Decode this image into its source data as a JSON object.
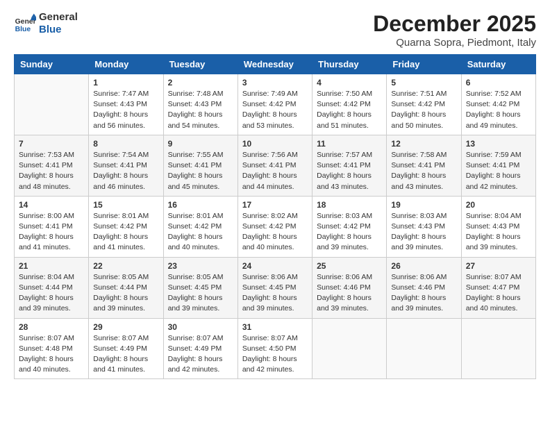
{
  "logo": {
    "general": "General",
    "blue": "Blue"
  },
  "title": {
    "month_year": "December 2025",
    "location": "Quarna Sopra, Piedmont, Italy"
  },
  "days_of_week": [
    "Sunday",
    "Monday",
    "Tuesday",
    "Wednesday",
    "Thursday",
    "Friday",
    "Saturday"
  ],
  "weeks": [
    {
      "shaded": false,
      "days": [
        {
          "num": "",
          "empty": true,
          "sunrise": "",
          "sunset": "",
          "daylight": ""
        },
        {
          "num": "1",
          "empty": false,
          "sunrise": "Sunrise: 7:47 AM",
          "sunset": "Sunset: 4:43 PM",
          "daylight": "Daylight: 8 hours and 56 minutes."
        },
        {
          "num": "2",
          "empty": false,
          "sunrise": "Sunrise: 7:48 AM",
          "sunset": "Sunset: 4:43 PM",
          "daylight": "Daylight: 8 hours and 54 minutes."
        },
        {
          "num": "3",
          "empty": false,
          "sunrise": "Sunrise: 7:49 AM",
          "sunset": "Sunset: 4:42 PM",
          "daylight": "Daylight: 8 hours and 53 minutes."
        },
        {
          "num": "4",
          "empty": false,
          "sunrise": "Sunrise: 7:50 AM",
          "sunset": "Sunset: 4:42 PM",
          "daylight": "Daylight: 8 hours and 51 minutes."
        },
        {
          "num": "5",
          "empty": false,
          "sunrise": "Sunrise: 7:51 AM",
          "sunset": "Sunset: 4:42 PM",
          "daylight": "Daylight: 8 hours and 50 minutes."
        },
        {
          "num": "6",
          "empty": false,
          "sunrise": "Sunrise: 7:52 AM",
          "sunset": "Sunset: 4:42 PM",
          "daylight": "Daylight: 8 hours and 49 minutes."
        }
      ]
    },
    {
      "shaded": true,
      "days": [
        {
          "num": "7",
          "empty": false,
          "sunrise": "Sunrise: 7:53 AM",
          "sunset": "Sunset: 4:41 PM",
          "daylight": "Daylight: 8 hours and 48 minutes."
        },
        {
          "num": "8",
          "empty": false,
          "sunrise": "Sunrise: 7:54 AM",
          "sunset": "Sunset: 4:41 PM",
          "daylight": "Daylight: 8 hours and 46 minutes."
        },
        {
          "num": "9",
          "empty": false,
          "sunrise": "Sunrise: 7:55 AM",
          "sunset": "Sunset: 4:41 PM",
          "daylight": "Daylight: 8 hours and 45 minutes."
        },
        {
          "num": "10",
          "empty": false,
          "sunrise": "Sunrise: 7:56 AM",
          "sunset": "Sunset: 4:41 PM",
          "daylight": "Daylight: 8 hours and 44 minutes."
        },
        {
          "num": "11",
          "empty": false,
          "sunrise": "Sunrise: 7:57 AM",
          "sunset": "Sunset: 4:41 PM",
          "daylight": "Daylight: 8 hours and 43 minutes."
        },
        {
          "num": "12",
          "empty": false,
          "sunrise": "Sunrise: 7:58 AM",
          "sunset": "Sunset: 4:41 PM",
          "daylight": "Daylight: 8 hours and 43 minutes."
        },
        {
          "num": "13",
          "empty": false,
          "sunrise": "Sunrise: 7:59 AM",
          "sunset": "Sunset: 4:41 PM",
          "daylight": "Daylight: 8 hours and 42 minutes."
        }
      ]
    },
    {
      "shaded": false,
      "days": [
        {
          "num": "14",
          "empty": false,
          "sunrise": "Sunrise: 8:00 AM",
          "sunset": "Sunset: 4:41 PM",
          "daylight": "Daylight: 8 hours and 41 minutes."
        },
        {
          "num": "15",
          "empty": false,
          "sunrise": "Sunrise: 8:01 AM",
          "sunset": "Sunset: 4:42 PM",
          "daylight": "Daylight: 8 hours and 41 minutes."
        },
        {
          "num": "16",
          "empty": false,
          "sunrise": "Sunrise: 8:01 AM",
          "sunset": "Sunset: 4:42 PM",
          "daylight": "Daylight: 8 hours and 40 minutes."
        },
        {
          "num": "17",
          "empty": false,
          "sunrise": "Sunrise: 8:02 AM",
          "sunset": "Sunset: 4:42 PM",
          "daylight": "Daylight: 8 hours and 40 minutes."
        },
        {
          "num": "18",
          "empty": false,
          "sunrise": "Sunrise: 8:03 AM",
          "sunset": "Sunset: 4:42 PM",
          "daylight": "Daylight: 8 hours and 39 minutes."
        },
        {
          "num": "19",
          "empty": false,
          "sunrise": "Sunrise: 8:03 AM",
          "sunset": "Sunset: 4:43 PM",
          "daylight": "Daylight: 8 hours and 39 minutes."
        },
        {
          "num": "20",
          "empty": false,
          "sunrise": "Sunrise: 8:04 AM",
          "sunset": "Sunset: 4:43 PM",
          "daylight": "Daylight: 8 hours and 39 minutes."
        }
      ]
    },
    {
      "shaded": true,
      "days": [
        {
          "num": "21",
          "empty": false,
          "sunrise": "Sunrise: 8:04 AM",
          "sunset": "Sunset: 4:44 PM",
          "daylight": "Daylight: 8 hours and 39 minutes."
        },
        {
          "num": "22",
          "empty": false,
          "sunrise": "Sunrise: 8:05 AM",
          "sunset": "Sunset: 4:44 PM",
          "daylight": "Daylight: 8 hours and 39 minutes."
        },
        {
          "num": "23",
          "empty": false,
          "sunrise": "Sunrise: 8:05 AM",
          "sunset": "Sunset: 4:45 PM",
          "daylight": "Daylight: 8 hours and 39 minutes."
        },
        {
          "num": "24",
          "empty": false,
          "sunrise": "Sunrise: 8:06 AM",
          "sunset": "Sunset: 4:45 PM",
          "daylight": "Daylight: 8 hours and 39 minutes."
        },
        {
          "num": "25",
          "empty": false,
          "sunrise": "Sunrise: 8:06 AM",
          "sunset": "Sunset: 4:46 PM",
          "daylight": "Daylight: 8 hours and 39 minutes."
        },
        {
          "num": "26",
          "empty": false,
          "sunrise": "Sunrise: 8:06 AM",
          "sunset": "Sunset: 4:46 PM",
          "daylight": "Daylight: 8 hours and 39 minutes."
        },
        {
          "num": "27",
          "empty": false,
          "sunrise": "Sunrise: 8:07 AM",
          "sunset": "Sunset: 4:47 PM",
          "daylight": "Daylight: 8 hours and 40 minutes."
        }
      ]
    },
    {
      "shaded": false,
      "days": [
        {
          "num": "28",
          "empty": false,
          "sunrise": "Sunrise: 8:07 AM",
          "sunset": "Sunset: 4:48 PM",
          "daylight": "Daylight: 8 hours and 40 minutes."
        },
        {
          "num": "29",
          "empty": false,
          "sunrise": "Sunrise: 8:07 AM",
          "sunset": "Sunset: 4:49 PM",
          "daylight": "Daylight: 8 hours and 41 minutes."
        },
        {
          "num": "30",
          "empty": false,
          "sunrise": "Sunrise: 8:07 AM",
          "sunset": "Sunset: 4:49 PM",
          "daylight": "Daylight: 8 hours and 42 minutes."
        },
        {
          "num": "31",
          "empty": false,
          "sunrise": "Sunrise: 8:07 AM",
          "sunset": "Sunset: 4:50 PM",
          "daylight": "Daylight: 8 hours and 42 minutes."
        },
        {
          "num": "",
          "empty": true,
          "sunrise": "",
          "sunset": "",
          "daylight": ""
        },
        {
          "num": "",
          "empty": true,
          "sunrise": "",
          "sunset": "",
          "daylight": ""
        },
        {
          "num": "",
          "empty": true,
          "sunrise": "",
          "sunset": "",
          "daylight": ""
        }
      ]
    }
  ]
}
